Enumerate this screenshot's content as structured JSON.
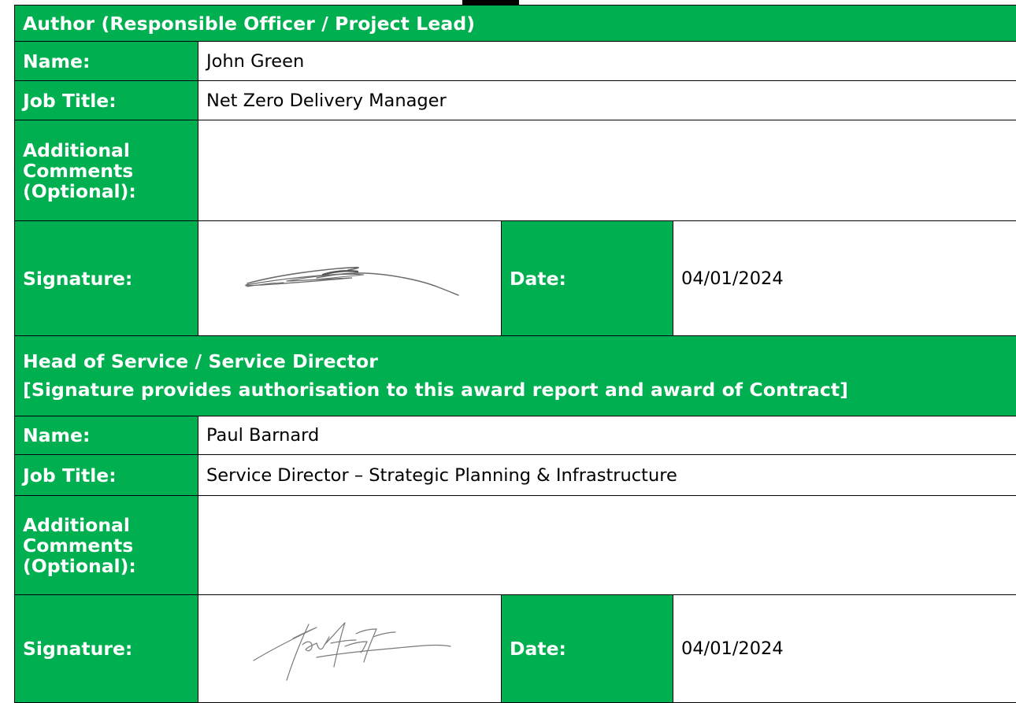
{
  "sections": [
    {
      "title": "Author (Responsible Officer / Project Lead)",
      "subtitle": "",
      "name_label": "Name:",
      "name_value": "John Green",
      "job_title_label": "Job Title:",
      "job_title_value": "Net Zero Delivery Manager",
      "comments_label": "Additional Comments (Optional):",
      "comments_value": "",
      "signature_label": "Signature:",
      "date_label": "Date:",
      "date_value": "04/01/2024"
    },
    {
      "title": "Head of Service / Service Director",
      "subtitle": "[Signature provides authorisation to this award report and award of Contract]",
      "name_label": "Name:",
      "name_value": "Paul Barnard",
      "job_title_label": "Job Title:",
      "job_title_value": "Service Director – Strategic Planning & Infrastructure",
      "comments_label": "Additional Comments (Optional):",
      "comments_value": "",
      "signature_label": "Signature:",
      "date_label": "Date:",
      "date_value": "04/01/2024"
    }
  ],
  "colors": {
    "header_green": "#00b050",
    "label_text": "#ffffff",
    "border": "#000000"
  }
}
